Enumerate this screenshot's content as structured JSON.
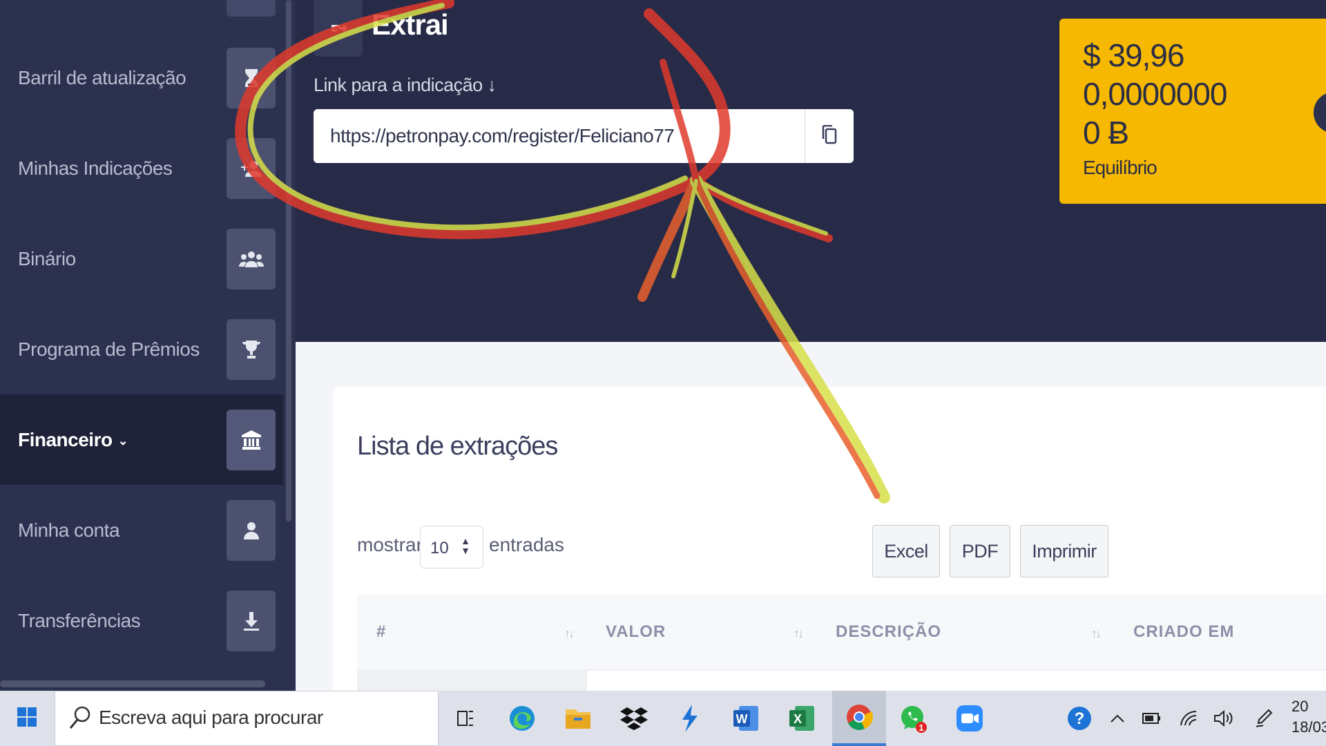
{
  "sidebar": {
    "items": [
      {
        "label": "Barril de atualização",
        "icon": "hourglass-icon"
      },
      {
        "label": "Minhas Indicações",
        "icon": "add-user-icon"
      },
      {
        "label": "Binário",
        "icon": "group-icon"
      },
      {
        "label": "Programa de Prêmios",
        "icon": "trophy-icon"
      },
      {
        "label": "Financeiro",
        "icon": "bank-icon",
        "active": true
      },
      {
        "label": "Minha conta",
        "icon": "user-icon"
      },
      {
        "label": "Transferências",
        "icon": "download-icon"
      }
    ]
  },
  "header": {
    "title": "Extrai",
    "ref_label": "Link para a indicação ↓",
    "ref_link": "https://petronpay.com/register/Feliciano77"
  },
  "balance": {
    "usd": "$ 39,96",
    "btc": "0,0000000",
    "b": "0 Ƀ",
    "label": "Equilíbrio",
    "color": "#f6b800"
  },
  "table": {
    "title": "Lista de extrações",
    "show_label": "mostrar",
    "entries_value": "10",
    "entries_label": "entradas",
    "buttons": {
      "excel": "Excel",
      "pdf": "PDF",
      "print": "Imprimir"
    },
    "columns": [
      "#",
      "VALOR",
      "DESCRIÇÃO",
      "CRIADO EM"
    ]
  },
  "taskbar": {
    "search_placeholder": "Escreva aqui para procurar",
    "apps": [
      "task-view-icon",
      "edge-icon",
      "file-explorer-icon",
      "dropbox-icon",
      "app-bolt-icon",
      "word-icon",
      "excel-icon",
      "chrome-icon",
      "whatsapp-icon",
      "zoom-icon"
    ],
    "whatsapp_badge": "1",
    "clock_time": "20",
    "clock_date": "18/03"
  }
}
